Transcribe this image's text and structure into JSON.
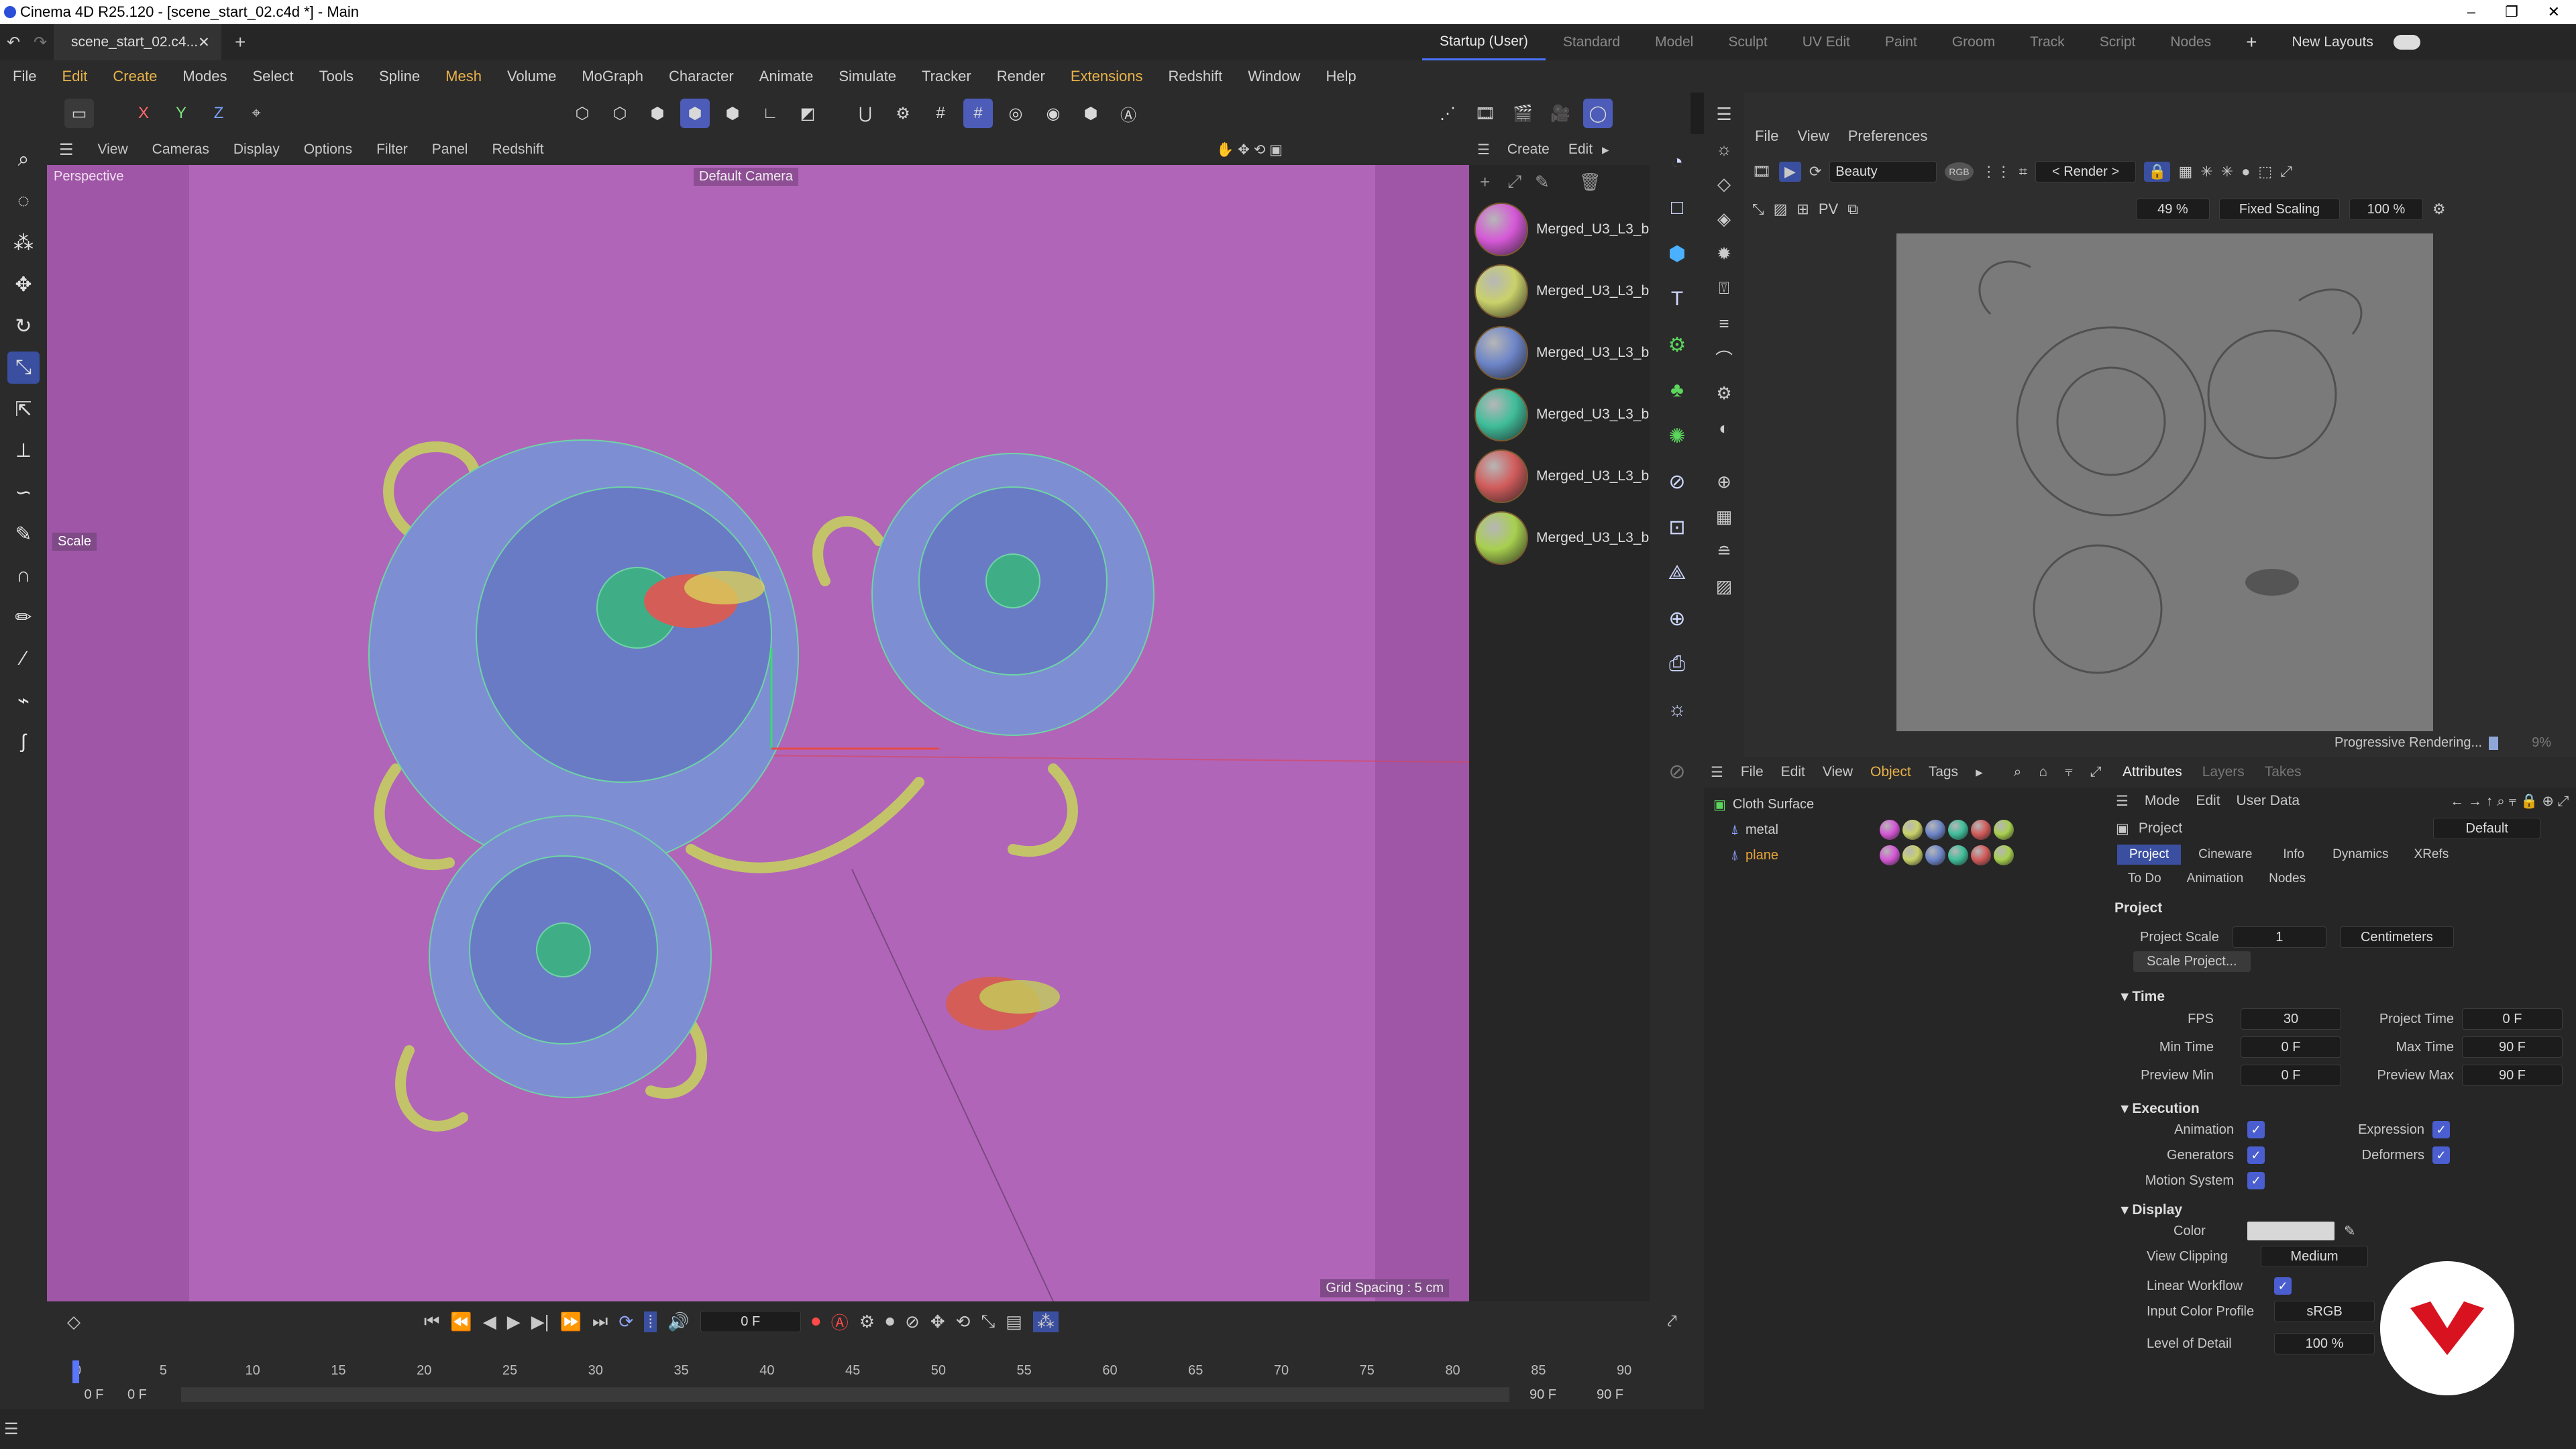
{
  "window": {
    "title": "Cinema 4D R25.120 - [scene_start_02.c4d *] - Main",
    "minimize": "–",
    "restore": "❐",
    "close": "✕"
  },
  "tabs": {
    "file_tab": "scene_start_02.c4...",
    "close": "✕",
    "add": "+",
    "layouts": [
      "Startup (User)",
      "Standard",
      "Model",
      "Sculpt",
      "UV Edit",
      "Paint",
      "Groom",
      "Track",
      "Script",
      "Nodes"
    ],
    "plus": "+",
    "new_layouts": "New Layouts"
  },
  "menu": [
    "File",
    "Edit",
    "Create",
    "Modes",
    "Select",
    "Tools",
    "Spline",
    "Mesh",
    "Volume",
    "MoGraph",
    "Character",
    "Animate",
    "Simulate",
    "Tracker",
    "Render",
    "Extensions",
    "Redshift",
    "Window",
    "Help"
  ],
  "axis_buttons": [
    "X",
    "Y",
    "Z"
  ],
  "viewport": {
    "menu": [
      "View",
      "Cameras",
      "Display",
      "Options",
      "Filter",
      "Panel",
      "Redshift"
    ],
    "label": "Perspective",
    "camera": "Default Camera",
    "scale_label": "Scale",
    "grid_spacing": "Grid Spacing : 5 cm"
  },
  "materials": {
    "menu": [
      "Create",
      "Edit"
    ],
    "items": [
      {
        "name": "Merged_U3_L3_b",
        "color": "#d558d6"
      },
      {
        "name": "Merged_U3_L3_b",
        "color": "#c9d16a"
      },
      {
        "name": "Merged_U3_L3_b",
        "color": "#6d85c8"
      },
      {
        "name": "Merged_U3_L3_b",
        "color": "#3fbd9a"
      },
      {
        "name": "Merged_U3_L3_b",
        "color": "#d15b5b"
      },
      {
        "name": "Merged_U3_L3_b",
        "color": "#a8cf4f"
      }
    ]
  },
  "render_view": {
    "menu": [
      "File",
      "View",
      "Preferences"
    ],
    "pass": "Beauty",
    "rgb": "RGB",
    "render_dropdown": "< Render >",
    "zoom": "49 %",
    "scaling": "Fixed Scaling",
    "percent": "100 %",
    "status": "Progressive Rendering...",
    "progress_text": "9%",
    "progress": 0.09
  },
  "objects": {
    "menu": [
      "File",
      "Edit",
      "View",
      "Object",
      "Tags"
    ],
    "items": [
      {
        "name": "Cloth Surface",
        "color": "#d0d0d0"
      },
      {
        "name": "metal",
        "color": "#d0d0d0"
      },
      {
        "name": "plane",
        "color": "#e7a43a"
      }
    ]
  },
  "attributes": {
    "tabs": [
      "Attributes",
      "Layers",
      "Takes"
    ],
    "menu": [
      "Mode",
      "Edit",
      "User Data"
    ],
    "object": "Project",
    "preset": "Default",
    "subtabs": [
      "Project",
      "Cineware",
      "Info",
      "Dynamics",
      "XRefs"
    ],
    "subtabs2": [
      "To Do",
      "Animation",
      "Nodes"
    ],
    "section_project": "Project",
    "project_scale_label": "Project Scale",
    "project_scale": "1",
    "project_unit": "Centimeters",
    "scale_button": "Scale Project...",
    "time_section": "Time",
    "fps_label": "FPS",
    "fps": "30",
    "project_time_label": "Project Time",
    "project_time": "0 F",
    "min_time_label": "Min Time",
    "min_time": "0 F",
    "max_time_label": "Max Time",
    "max_time": "90 F",
    "preview_min_label": "Preview Min",
    "preview_min": "0 F",
    "preview_max_label": "Preview Max",
    "preview_max": "90 F",
    "execution_section": "Execution",
    "animation_label": "Animation",
    "expression_label": "Expression",
    "generators_label": "Generators",
    "deformers_label": "Deformers",
    "motion_label": "Motion System",
    "display_section": "Display",
    "color_label": "Color",
    "clipping_label": "View Clipping",
    "clipping": "Medium",
    "linear_label": "Linear Workflow",
    "icp_label": "Input Color Profile",
    "icp": "sRGB",
    "lod_label": "Level of Detail",
    "lod": "100 %"
  },
  "timeline": {
    "frame": "0 F",
    "ticks": [
      "0",
      "5",
      "10",
      "15",
      "20",
      "25",
      "30",
      "35",
      "40",
      "45",
      "50",
      "55",
      "60",
      "65",
      "70",
      "75",
      "80",
      "85",
      "90"
    ],
    "start": "0 F",
    "start2": "0 F",
    "end": "90 F",
    "end2": "90 F"
  }
}
